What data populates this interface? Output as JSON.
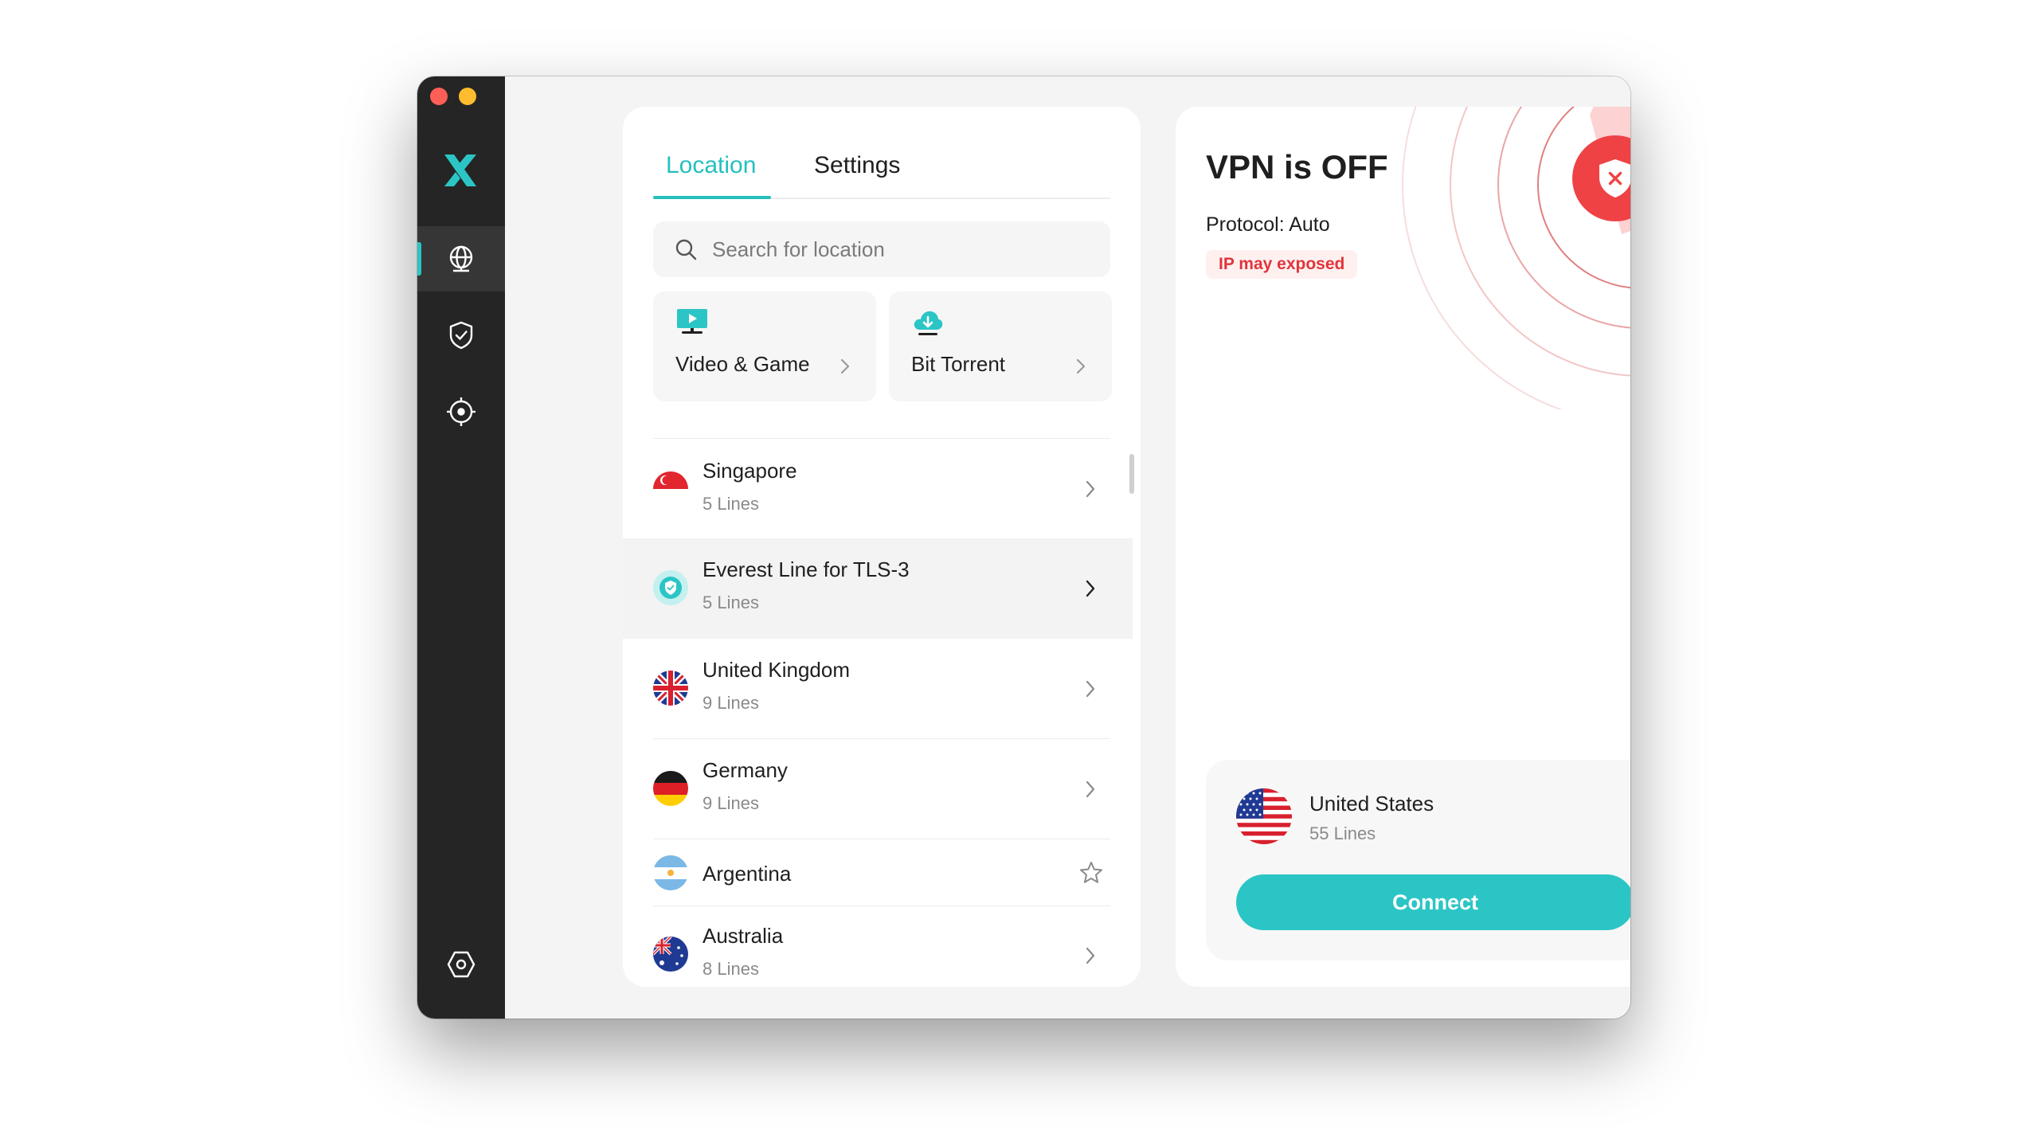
{
  "window": {
    "controls": [
      "close",
      "minimize"
    ],
    "logo_icon": "x-logo-icon"
  },
  "sidebar": {
    "items": [
      {
        "id": "locations",
        "icon": "globe-icon",
        "active": true
      },
      {
        "id": "protection",
        "icon": "shield-check-icon",
        "active": false
      },
      {
        "id": "target",
        "icon": "crosshair-icon",
        "active": false
      }
    ],
    "bottom_icon": "hexagon-settings-icon"
  },
  "tabs": [
    {
      "label": "Location",
      "active": true
    },
    {
      "label": "Settings",
      "active": false
    }
  ],
  "search": {
    "placeholder": "Search for location",
    "value": ""
  },
  "quick_access": [
    {
      "label": "Video & Game",
      "icon": "monitor-play-icon"
    },
    {
      "label": "Bit Torrent",
      "icon": "cloud-download-icon"
    }
  ],
  "locations": [
    {
      "name": "Singapore",
      "lines": "5 Lines",
      "flag": "singapore-flag-icon"
    },
    {
      "name": "Everest Line for TLS-3",
      "lines": "5 Lines",
      "flag": "shield-badge-icon",
      "highlighted": true
    },
    {
      "name": "United Kingdom",
      "lines": "9 Lines",
      "flag": "uk-flag-icon"
    },
    {
      "name": "Germany",
      "lines": "9 Lines",
      "flag": "germany-flag-icon"
    },
    {
      "name": "Argentina",
      "lines": "",
      "flag": "argentina-flag-icon",
      "favoritable": true
    },
    {
      "name": "Australia",
      "lines": "8 Lines",
      "flag": "australia-flag-icon"
    }
  ],
  "status": {
    "title": "VPN is OFF",
    "protocol": "Protocol: Auto",
    "warning": "IP may exposed"
  },
  "selected_location": {
    "name": "United States",
    "lines": "55 Lines",
    "flag": "usa-flag-icon",
    "connect_label": "Connect"
  },
  "colors": {
    "accent": "#2cc5c5",
    "danger": "#ef4245",
    "sidebar": "#252525"
  }
}
